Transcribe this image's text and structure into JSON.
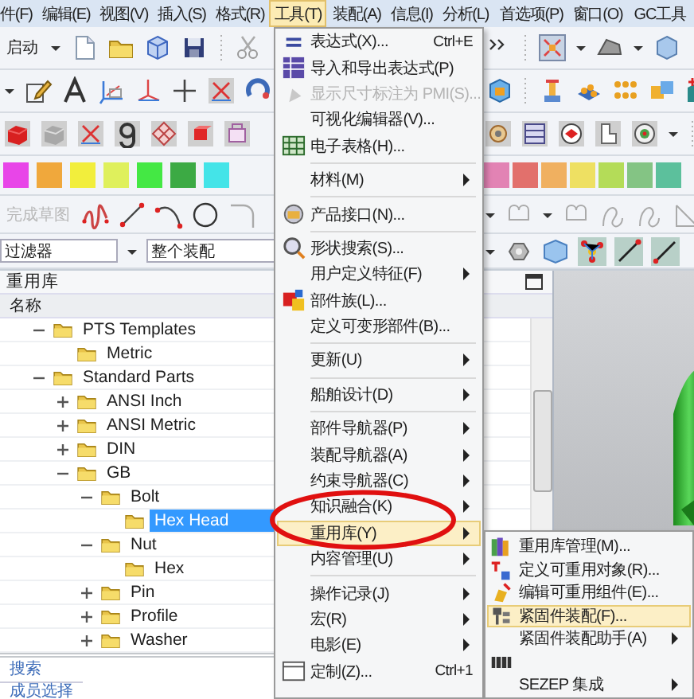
{
  "menubar": [
    {
      "label": "件(F)",
      "selected": false
    },
    {
      "label": "编辑(E)",
      "selected": false
    },
    {
      "label": "视图(V)",
      "selected": false
    },
    {
      "label": "插入(S)",
      "selected": false
    },
    {
      "label": "格式(R)",
      "selected": false
    },
    {
      "label": "工具(T)",
      "selected": true
    },
    {
      "label": "装配(A)",
      "selected": false
    },
    {
      "label": "信息(I)",
      "selected": false
    },
    {
      "label": "分析(L)",
      "selected": false
    },
    {
      "label": "首选项(P)",
      "selected": false
    },
    {
      "label": "窗口(O)",
      "selected": false
    },
    {
      "label": "GC工具",
      "selected": false
    }
  ],
  "toolbar": {
    "start_button": "启动",
    "sketch_button": {
      "label": "完成草图",
      "disabled": true
    },
    "filter": "过滤器",
    "scope": "整个装配",
    "swatches_left": [
      {
        "color": "#e845e8"
      },
      {
        "color": "#f0a83c"
      },
      {
        "color": "#f2ee3c"
      },
      {
        "color": "#dff05c"
      },
      {
        "color": "#44e844"
      },
      {
        "color": "#3caa44"
      },
      {
        "color": "#44e4e8"
      }
    ],
    "swatches_right": [
      {
        "color": "#e283b4"
      },
      {
        "color": "#e2706c"
      },
      {
        "color": "#f0b060"
      },
      {
        "color": "#eee062"
      },
      {
        "color": "#b4dc58"
      },
      {
        "color": "#84c484"
      },
      {
        "color": "#5cc09c"
      }
    ]
  },
  "panel": {
    "title": "重用库",
    "column": "名称",
    "tree": [
      {
        "label": "PTS Templates",
        "expanded": true,
        "selected": false,
        "children": [
          {
            "label": "Metric",
            "selected": false
          }
        ]
      },
      {
        "label": "Standard Parts",
        "expanded": true,
        "selected": false,
        "children": [
          {
            "label": "ANSI Inch",
            "expanded": false,
            "selected": false
          },
          {
            "label": "ANSI Metric",
            "expanded": false,
            "selected": false
          },
          {
            "label": "DIN",
            "expanded": false,
            "selected": false
          },
          {
            "label": "GB",
            "expanded": true,
            "selected": false,
            "children": [
              {
                "label": "Bolt",
                "expanded": true,
                "selected": false,
                "children": [
                  {
                    "label": "Hex Head",
                    "selected": true
                  }
                ]
              },
              {
                "label": "Nut",
                "expanded": true,
                "selected": false,
                "children": [
                  {
                    "label": "Hex",
                    "selected": false
                  }
                ]
              },
              {
                "label": "Pin",
                "expanded": false,
                "selected": false
              },
              {
                "label": "Profile",
                "expanded": false,
                "selected": false
              },
              {
                "label": "Washer",
                "expanded": false,
                "selected": false
              }
            ]
          }
        ]
      }
    ],
    "search_link": "搜索",
    "member_section": "成员选择"
  },
  "tools_menu": {
    "items": [
      {
        "kind": "item",
        "label": "表达式(X)...",
        "shortcut": "Ctrl+E",
        "submenu": false,
        "disabled": false,
        "selected": false
      },
      {
        "kind": "item",
        "label": "导入和导出表达式(P)",
        "submenu": false,
        "disabled": false,
        "selected": false
      },
      {
        "kind": "item",
        "label": "显示尺寸标注为 PMI(S)...",
        "submenu": false,
        "disabled": true,
        "selected": false
      },
      {
        "kind": "item",
        "label": "可视化编辑器(V)...",
        "submenu": false,
        "disabled": false,
        "selected": false
      },
      {
        "kind": "item",
        "label": "电子表格(H)...",
        "submenu": false,
        "disabled": false,
        "selected": false
      },
      {
        "kind": "separator"
      },
      {
        "kind": "item",
        "label": "材料(M)",
        "submenu": true,
        "disabled": false,
        "selected": false
      },
      {
        "kind": "separator"
      },
      {
        "kind": "item",
        "label": "产品接口(N)...",
        "submenu": false,
        "disabled": false,
        "selected": false
      },
      {
        "kind": "separator"
      },
      {
        "kind": "item",
        "label": "形状搜索(S)...",
        "submenu": false,
        "disabled": false,
        "selected": false
      },
      {
        "kind": "item",
        "label": "用户定义特征(F)",
        "submenu": true,
        "disabled": false,
        "selected": false
      },
      {
        "kind": "item",
        "label": "部件族(L)...",
        "submenu": false,
        "disabled": false,
        "selected": false
      },
      {
        "kind": "item",
        "label": "定义可变形部件(B)...",
        "submenu": false,
        "disabled": false,
        "selected": false
      },
      {
        "kind": "separator"
      },
      {
        "kind": "item",
        "label": "更新(U)",
        "submenu": true,
        "disabled": false,
        "selected": false
      },
      {
        "kind": "separator"
      },
      {
        "kind": "item",
        "label": "船舶设计(D)",
        "submenu": true,
        "disabled": false,
        "selected": false
      },
      {
        "kind": "separator"
      },
      {
        "kind": "item",
        "label": "部件导航器(P)",
        "submenu": true,
        "disabled": false,
        "selected": false
      },
      {
        "kind": "item",
        "label": "装配导航器(A)",
        "submenu": true,
        "disabled": false,
        "selected": false
      },
      {
        "kind": "item",
        "label": "约束导航器(C)",
        "submenu": true,
        "disabled": false,
        "selected": false
      },
      {
        "kind": "item",
        "label": "知识融合(K)",
        "submenu": true,
        "disabled": false,
        "selected": false
      },
      {
        "kind": "item",
        "label": "重用库(Y)",
        "submenu": true,
        "disabled": false,
        "selected": true
      },
      {
        "kind": "item",
        "label": "内容管理(U)",
        "submenu": true,
        "disabled": false,
        "selected": false
      },
      {
        "kind": "separator"
      },
      {
        "kind": "item",
        "label": "操作记录(J)",
        "submenu": true,
        "disabled": false,
        "selected": false
      },
      {
        "kind": "item",
        "label": "宏(R)",
        "submenu": true,
        "disabled": false,
        "selected": false
      },
      {
        "kind": "item",
        "label": "电影(E)",
        "submenu": true,
        "disabled": false,
        "selected": false
      },
      {
        "kind": "item",
        "label": "定制(Z)...",
        "shortcut": "Ctrl+1",
        "submenu": false,
        "disabled": false,
        "selected": false
      }
    ]
  },
  "reuse_submenu": {
    "items": [
      {
        "kind": "item",
        "label": "重用库管理(M)...",
        "submenu": false,
        "selected": false
      },
      {
        "kind": "item",
        "label": "定义可重用对象(R)...",
        "submenu": false,
        "selected": false
      },
      {
        "kind": "item",
        "label": "编辑可重用组件(E)...",
        "submenu": false,
        "selected": false
      },
      {
        "kind": "item",
        "label": "紧固件装配(F)...",
        "submenu": false,
        "selected": true
      },
      {
        "kind": "item",
        "label": "紧固件装配助手(A)",
        "submenu": true,
        "selected": false
      },
      {
        "kind": "item",
        "submenu": false,
        "selected": false
      },
      {
        "kind": "item",
        "label": "SEZEP 集成",
        "submenu": true,
        "selected": false
      }
    ]
  },
  "annotation": {
    "kind": "ellipse"
  }
}
